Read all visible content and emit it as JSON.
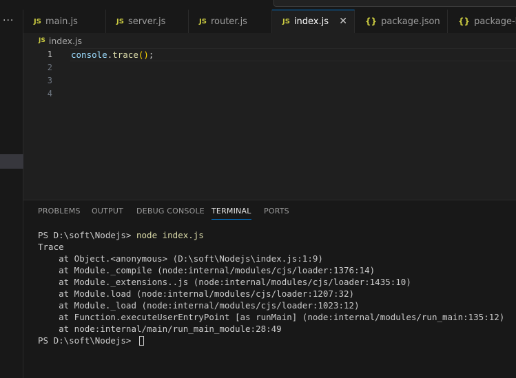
{
  "tabs": [
    {
      "label": "main.js",
      "icon": "JS",
      "active": false
    },
    {
      "label": "server.js",
      "icon": "JS",
      "active": false
    },
    {
      "label": "router.js",
      "icon": "JS",
      "active": false
    },
    {
      "label": "index.js",
      "icon": "JS",
      "active": true
    },
    {
      "label": "package.json",
      "icon": "{}",
      "active": false
    },
    {
      "label": "package-lock.json",
      "icon": "{}",
      "active": false
    }
  ],
  "breadcrumb": {
    "icon": "JS",
    "file": "index.js"
  },
  "editor": {
    "line_numbers": [
      "1",
      "2",
      "3",
      "4"
    ],
    "code": {
      "object": "console",
      "dot": ".",
      "method": "trace",
      "open": "(",
      "close": ")",
      "semi": ";"
    }
  },
  "panel": {
    "tabs": [
      "PROBLEMS",
      "OUTPUT",
      "DEBUG CONSOLE",
      "TERMINAL",
      "PORTS"
    ],
    "active_tab": "TERMINAL"
  },
  "terminal": {
    "prompt": "PS D:\\soft\\Nodejs> ",
    "command": "node index.js",
    "output": [
      "Trace",
      "    at Object.<anonymous> (D:\\soft\\Nodejs\\index.js:1:9)",
      "    at Module._compile (node:internal/modules/cjs/loader:1376:14)",
      "    at Module._extensions..js (node:internal/modules/cjs/loader:1435:10)",
      "    at Module.load (node:internal/modules/cjs/loader:1207:32)",
      "    at Module._load (node:internal/modules/cjs/loader:1023:12)",
      "    at Function.executeUserEntryPoint [as runMain] (node:internal/modules/run_main:135:12)",
      "    at node:internal/main/run_main_module:28:49"
    ],
    "final_prompt": "PS D:\\soft\\Nodejs> "
  },
  "colors": {
    "accent": "#0078d4",
    "js_icon": "#cbcb41",
    "command": "#dcdcaa"
  }
}
